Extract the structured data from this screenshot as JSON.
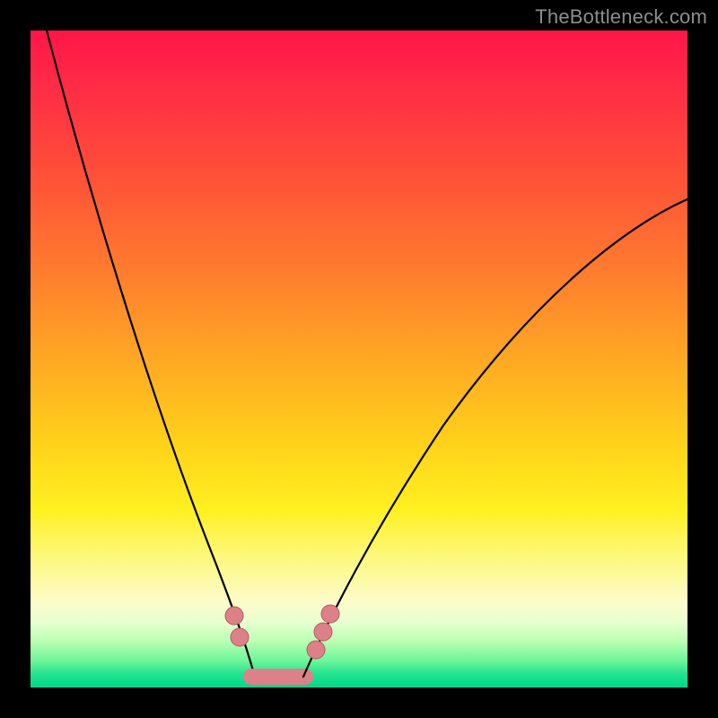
{
  "watermark": "TheBottleneck.com",
  "colors": {
    "background": "#000000",
    "gradient_top": "#ff1648",
    "gradient_mid": "#ffd21a",
    "gradient_bottom": "#00d78a",
    "curve": "#000000",
    "marker_fill": "#dd8088",
    "marker_stroke": "#b25b63"
  },
  "chart_data": {
    "type": "line",
    "title": "",
    "xlabel": "",
    "ylabel": "",
    "xlim": [
      0,
      100
    ],
    "ylim": [
      0,
      100
    ],
    "grid": false,
    "legend": false,
    "series": [
      {
        "name": "left-branch",
        "x": [
          3,
          6,
          10,
          14,
          18,
          22,
          25,
          28,
          30,
          32,
          34
        ],
        "y": [
          100,
          85,
          67,
          52,
          39,
          27,
          19,
          12,
          7,
          3,
          0
        ]
      },
      {
        "name": "right-branch",
        "x": [
          42,
          45,
          49,
          54,
          60,
          67,
          75,
          84,
          93,
          100
        ],
        "y": [
          0,
          5,
          12,
          21,
          31,
          41,
          51,
          60,
          68,
          74
        ]
      },
      {
        "name": "valley-floor",
        "x": [
          34,
          36,
          38,
          40,
          42
        ],
        "y": [
          0,
          0,
          0,
          0,
          0
        ]
      }
    ],
    "markers": [
      {
        "series": "left-branch",
        "x": 30,
        "y": 7
      },
      {
        "series": "left-branch",
        "x": 30.5,
        "y": 4
      },
      {
        "series": "right-branch",
        "x": 44,
        "y": 4
      },
      {
        "series": "right-branch",
        "x": 45,
        "y": 6
      },
      {
        "series": "right-branch",
        "x": 46,
        "y": 8
      }
    ],
    "notes": "V-shaped bottleneck curve on a red-to-green severity gradient. Minimum around x≈38, y≈0. Axes are unmarked in the source image; x and y are normalized 0–100 estimates read from pixel position."
  }
}
